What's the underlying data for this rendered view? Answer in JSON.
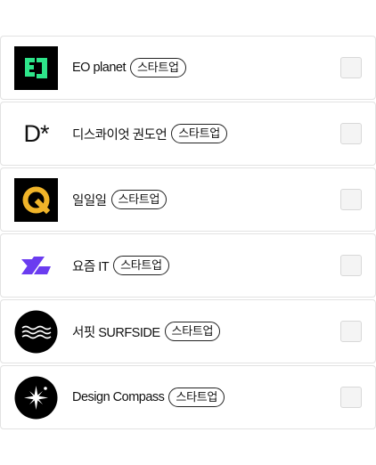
{
  "companies": [
    {
      "name": "EO planet",
      "badge": "스타트업",
      "logo_icon": "eo-planet-logo"
    },
    {
      "name": "디스콰이엇 권도언",
      "badge": "스타트업",
      "logo_icon": "disquiet-logo",
      "logo_text": "D*"
    },
    {
      "name": "일일일",
      "badge": "스타트업",
      "logo_icon": "ililil-logo"
    },
    {
      "name": "요즘 IT",
      "badge": "스타트업",
      "logo_icon": "yozm-it-logo"
    },
    {
      "name": "서핏 SURFSIDE",
      "badge": "스타트업",
      "logo_icon": "surfit-logo"
    },
    {
      "name": "Design Compass",
      "badge": "스타트업",
      "logo_icon": "design-compass-logo"
    }
  ],
  "colors": {
    "eo_green": "#2ee58a",
    "ililil_yellow": "#f0b429",
    "yozm_purple": "#6b3cf0"
  }
}
